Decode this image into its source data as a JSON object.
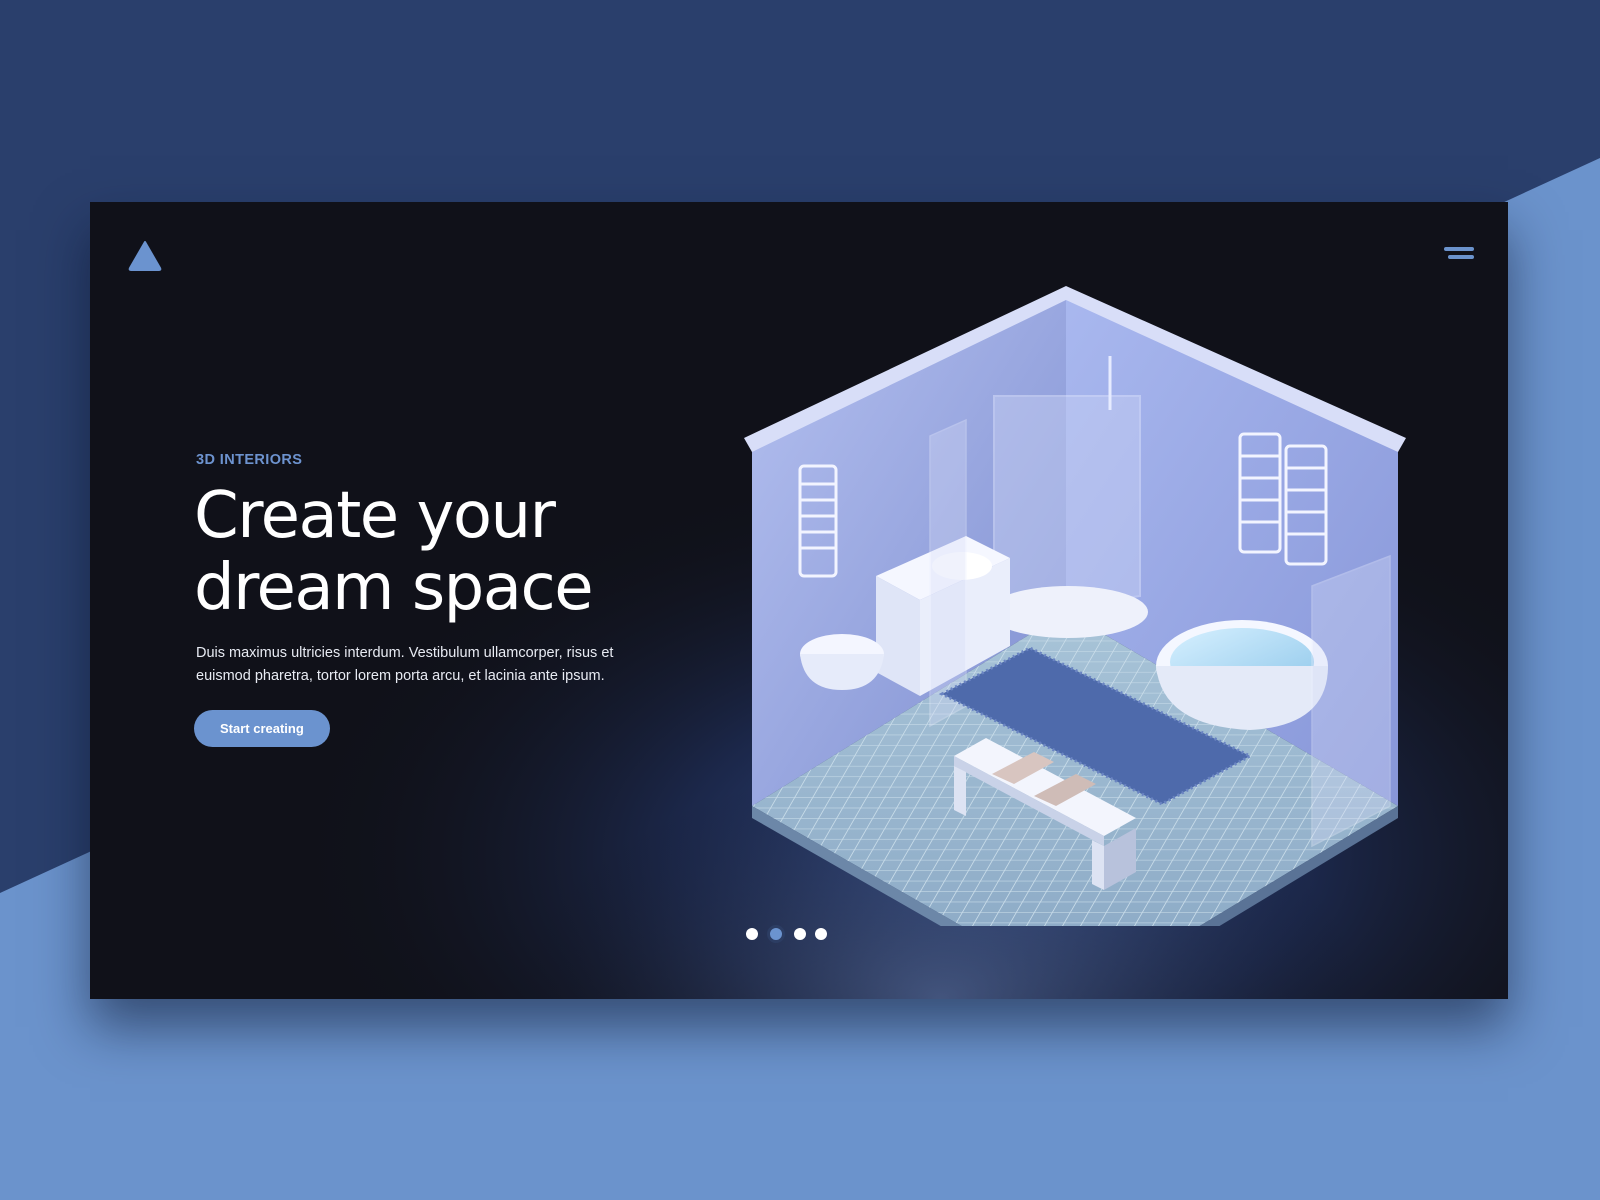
{
  "page": {
    "background_top": "#2a3f6c",
    "background_bottom": "#6b93cc",
    "accent": "#6b93cf"
  },
  "header": {
    "logo_icon": "triangle-logo-icon",
    "menu_icon": "hamburger-menu-icon"
  },
  "hero": {
    "eyebrow": "3D INTERIORS",
    "title_line1": "Create your",
    "title_line2": "dream space",
    "subtitle": "Duis maximus ultricies interdum. Vestibulum ullamcorper, risus et euismod pharetra, tortor lorem porta arcu, et lacinia ante ipsum.",
    "cta_label": "Start creating"
  },
  "illustration": {
    "subject": "isometric-bathroom-icon"
  },
  "carousel": {
    "slide_count": 4,
    "active_index": 1
  }
}
